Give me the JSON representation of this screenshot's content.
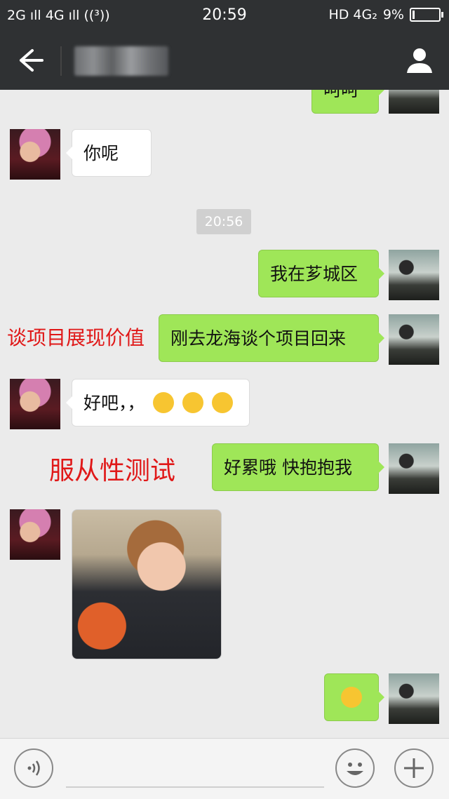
{
  "status_bar": {
    "left": "2G ıll 4G ıll ((³))",
    "time": "20:59",
    "network": "HD 4G₂",
    "battery_text": "9%",
    "battery_level": 0.09
  },
  "nav": {
    "back_icon": "arrow-left-icon",
    "profile_icon": "person-icon"
  },
  "messages": [
    {
      "side": "out",
      "text": "呵呵"
    },
    {
      "side": "in",
      "text": "你呢"
    },
    {
      "timestamp": "20:56"
    },
    {
      "side": "out",
      "text": "我在芗城区"
    },
    {
      "side": "out",
      "text": "刚去龙海谈个项目回来"
    },
    {
      "side": "in",
      "text": "好吧，，"
    },
    {
      "side": "out",
      "text": "好累哦 快抱抱我"
    },
    {
      "side": "in",
      "type": "image"
    },
    {
      "side": "out",
      "type": "emoji"
    }
  ],
  "annotations": {
    "a1": "谈项目展现价值",
    "a2": "服从性测试"
  },
  "colors": {
    "out_bubble": "#9fe658",
    "in_bubble": "#ffffff",
    "annotation": "#e01818",
    "header": "#2f3133"
  },
  "input_bar": {
    "voice_icon": "voice-icon",
    "emoji_icon": "smiley-icon",
    "plus_icon": "plus-icon"
  }
}
